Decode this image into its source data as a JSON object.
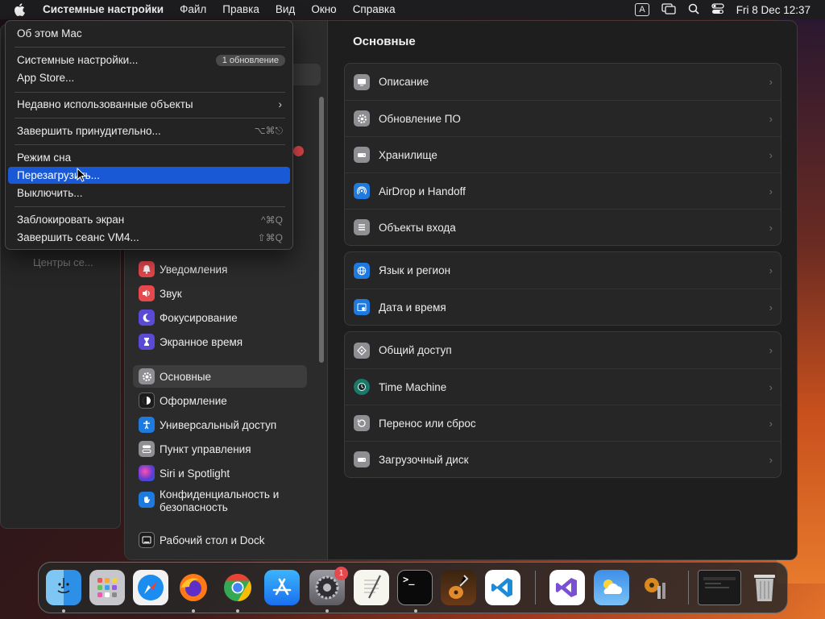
{
  "menubar": {
    "app_name": "Системные настройки",
    "items": [
      "Файл",
      "Правка",
      "Вид",
      "Окно",
      "Справка"
    ],
    "input_badge": "A",
    "clock": "Fri 8 Dec  12:37"
  },
  "back_window": {
    "faded_label": "Центры се..."
  },
  "apple_menu": {
    "about": "Об этом Mac",
    "system_settings": "Системные настройки...",
    "update_pill": "1 обновление",
    "app_store": "App Store...",
    "recent": "Недавно использованные объекты",
    "force_quit": "Завершить принудительно...",
    "force_quit_shortcut": "⌥⌘⎋",
    "sleep": "Режим сна",
    "restart": "Перезагрузить...",
    "shutdown": "Выключить...",
    "lock": "Заблокировать экран",
    "lock_shortcut": "^⌘Q",
    "logout": "Завершить сеанс VM4...",
    "logout_shortcut": "⇧⌘Q"
  },
  "sidebar": {
    "items": [
      {
        "label": "Уведомления",
        "icon": "bell-icon",
        "color": "#e5484d"
      },
      {
        "label": "Звук",
        "icon": "speaker-icon",
        "color": "#e5484d"
      },
      {
        "label": "Фокусирование",
        "icon": "moon-icon",
        "color": "#5b4ad6"
      },
      {
        "label": "Экранное время",
        "icon": "hourglass-icon",
        "color": "#5b4ad6"
      },
      {
        "label": "Основные",
        "icon": "gear-icon",
        "color": "#8e8e93"
      },
      {
        "label": "Оформление",
        "icon": "appearance-icon",
        "color": "#1c1c1c"
      },
      {
        "label": "Универсальный доступ",
        "icon": "accessibility-icon",
        "color": "#1f7ae0"
      },
      {
        "label": "Пункт управления",
        "icon": "control-center-icon",
        "color": "#8e8e93"
      },
      {
        "label": "Siri и Spotlight",
        "icon": "siri-icon",
        "color": "#b03ad6"
      },
      {
        "label": "Конфиденциальность и безопасность",
        "icon": "hand-icon",
        "color": "#1f7ae0"
      },
      {
        "label": "Рабочий стол и Dock",
        "icon": "desktop-icon",
        "color": "#1c1c1c"
      }
    ]
  },
  "content": {
    "title": "Основные",
    "groups": [
      [
        {
          "label": "Описание",
          "icon": "display-icon",
          "color": "#8e8e93"
        },
        {
          "label": "Обновление ПО",
          "icon": "gear-badge-icon",
          "color": "#8e8e93"
        },
        {
          "label": "Хранилище",
          "icon": "drive-icon",
          "color": "#8e8e93"
        },
        {
          "label": "AirDrop и Handoff",
          "icon": "airdrop-icon",
          "color": "#1f7ae0"
        },
        {
          "label": "Объекты входа",
          "icon": "list-icon",
          "color": "#8e8e93"
        }
      ],
      [
        {
          "label": "Язык и регион",
          "icon": "globe-icon",
          "color": "#1f7ae0"
        },
        {
          "label": "Дата и время",
          "icon": "calendar-clock-icon",
          "color": "#1f7ae0"
        }
      ],
      [
        {
          "label": "Общий доступ",
          "icon": "sharing-icon",
          "color": "#8e8e93"
        },
        {
          "label": "Time Machine",
          "icon": "time-machine-icon",
          "color": "#1a7a6a"
        },
        {
          "label": "Перенос или сброс",
          "icon": "reset-icon",
          "color": "#8e8e93"
        },
        {
          "label": "Загрузочный диск",
          "icon": "startup-disk-icon",
          "color": "#8e8e93"
        }
      ]
    ]
  },
  "dock": {
    "settings_badge": "1"
  }
}
